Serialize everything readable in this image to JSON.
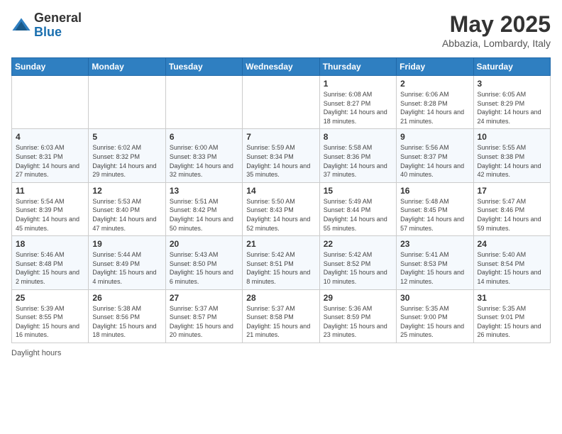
{
  "header": {
    "logo_general": "General",
    "logo_blue": "Blue",
    "month_title": "May 2025",
    "subtitle": "Abbazia, Lombardy, Italy"
  },
  "weekdays": [
    "Sunday",
    "Monday",
    "Tuesday",
    "Wednesday",
    "Thursday",
    "Friday",
    "Saturday"
  ],
  "footer": {
    "daylight_hours": "Daylight hours"
  },
  "weeks": [
    [
      {
        "day": "",
        "info": ""
      },
      {
        "day": "",
        "info": ""
      },
      {
        "day": "",
        "info": ""
      },
      {
        "day": "",
        "info": ""
      },
      {
        "day": "1",
        "info": "Sunrise: 6:08 AM\nSunset: 8:27 PM\nDaylight: 14 hours and 18 minutes."
      },
      {
        "day": "2",
        "info": "Sunrise: 6:06 AM\nSunset: 8:28 PM\nDaylight: 14 hours and 21 minutes."
      },
      {
        "day": "3",
        "info": "Sunrise: 6:05 AM\nSunset: 8:29 PM\nDaylight: 14 hours and 24 minutes."
      }
    ],
    [
      {
        "day": "4",
        "info": "Sunrise: 6:03 AM\nSunset: 8:31 PM\nDaylight: 14 hours and 27 minutes."
      },
      {
        "day": "5",
        "info": "Sunrise: 6:02 AM\nSunset: 8:32 PM\nDaylight: 14 hours and 29 minutes."
      },
      {
        "day": "6",
        "info": "Sunrise: 6:00 AM\nSunset: 8:33 PM\nDaylight: 14 hours and 32 minutes."
      },
      {
        "day": "7",
        "info": "Sunrise: 5:59 AM\nSunset: 8:34 PM\nDaylight: 14 hours and 35 minutes."
      },
      {
        "day": "8",
        "info": "Sunrise: 5:58 AM\nSunset: 8:36 PM\nDaylight: 14 hours and 37 minutes."
      },
      {
        "day": "9",
        "info": "Sunrise: 5:56 AM\nSunset: 8:37 PM\nDaylight: 14 hours and 40 minutes."
      },
      {
        "day": "10",
        "info": "Sunrise: 5:55 AM\nSunset: 8:38 PM\nDaylight: 14 hours and 42 minutes."
      }
    ],
    [
      {
        "day": "11",
        "info": "Sunrise: 5:54 AM\nSunset: 8:39 PM\nDaylight: 14 hours and 45 minutes."
      },
      {
        "day": "12",
        "info": "Sunrise: 5:53 AM\nSunset: 8:40 PM\nDaylight: 14 hours and 47 minutes."
      },
      {
        "day": "13",
        "info": "Sunrise: 5:51 AM\nSunset: 8:42 PM\nDaylight: 14 hours and 50 minutes."
      },
      {
        "day": "14",
        "info": "Sunrise: 5:50 AM\nSunset: 8:43 PM\nDaylight: 14 hours and 52 minutes."
      },
      {
        "day": "15",
        "info": "Sunrise: 5:49 AM\nSunset: 8:44 PM\nDaylight: 14 hours and 55 minutes."
      },
      {
        "day": "16",
        "info": "Sunrise: 5:48 AM\nSunset: 8:45 PM\nDaylight: 14 hours and 57 minutes."
      },
      {
        "day": "17",
        "info": "Sunrise: 5:47 AM\nSunset: 8:46 PM\nDaylight: 14 hours and 59 minutes."
      }
    ],
    [
      {
        "day": "18",
        "info": "Sunrise: 5:46 AM\nSunset: 8:48 PM\nDaylight: 15 hours and 2 minutes."
      },
      {
        "day": "19",
        "info": "Sunrise: 5:44 AM\nSunset: 8:49 PM\nDaylight: 15 hours and 4 minutes."
      },
      {
        "day": "20",
        "info": "Sunrise: 5:43 AM\nSunset: 8:50 PM\nDaylight: 15 hours and 6 minutes."
      },
      {
        "day": "21",
        "info": "Sunrise: 5:42 AM\nSunset: 8:51 PM\nDaylight: 15 hours and 8 minutes."
      },
      {
        "day": "22",
        "info": "Sunrise: 5:42 AM\nSunset: 8:52 PM\nDaylight: 15 hours and 10 minutes."
      },
      {
        "day": "23",
        "info": "Sunrise: 5:41 AM\nSunset: 8:53 PM\nDaylight: 15 hours and 12 minutes."
      },
      {
        "day": "24",
        "info": "Sunrise: 5:40 AM\nSunset: 8:54 PM\nDaylight: 15 hours and 14 minutes."
      }
    ],
    [
      {
        "day": "25",
        "info": "Sunrise: 5:39 AM\nSunset: 8:55 PM\nDaylight: 15 hours and 16 minutes."
      },
      {
        "day": "26",
        "info": "Sunrise: 5:38 AM\nSunset: 8:56 PM\nDaylight: 15 hours and 18 minutes."
      },
      {
        "day": "27",
        "info": "Sunrise: 5:37 AM\nSunset: 8:57 PM\nDaylight: 15 hours and 20 minutes."
      },
      {
        "day": "28",
        "info": "Sunrise: 5:37 AM\nSunset: 8:58 PM\nDaylight: 15 hours and 21 minutes."
      },
      {
        "day": "29",
        "info": "Sunrise: 5:36 AM\nSunset: 8:59 PM\nDaylight: 15 hours and 23 minutes."
      },
      {
        "day": "30",
        "info": "Sunrise: 5:35 AM\nSunset: 9:00 PM\nDaylight: 15 hours and 25 minutes."
      },
      {
        "day": "31",
        "info": "Sunrise: 5:35 AM\nSunset: 9:01 PM\nDaylight: 15 hours and 26 minutes."
      }
    ]
  ]
}
